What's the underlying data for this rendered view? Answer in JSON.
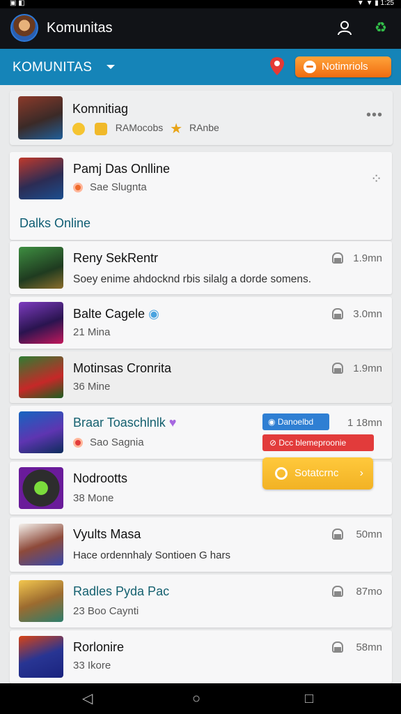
{
  "appbar": {
    "title": "Komunitas",
    "icons": [
      "user-icon",
      "recycle-icon"
    ]
  },
  "subbar": {
    "selector_label": "KOMUNITAS",
    "notif_button": "Notimriols"
  },
  "profile": {
    "name": "Komnitiag",
    "meta_text": "RAMocobs",
    "meta_text2": "RAnbe",
    "more": "•••"
  },
  "cards": [
    {
      "title": "Pamj Das Onlline",
      "subtitle": "Sae Slugnta",
      "section": "Dalks Online"
    },
    {
      "title": "Reny SekRentr",
      "subtitle": "Soey enime ahdocknd rbis silalg a dorde somens.",
      "time": "1.9mn"
    },
    {
      "title": "Balte Cagele",
      "subtitle": "21 Mina",
      "time": "3.0mn"
    },
    {
      "title": "Motinsas Cronrita",
      "subtitle": "36 Mine",
      "time": "1.9mn"
    },
    {
      "title": "Braar Toaschlnlk",
      "subtitle": "Sao Sagnia",
      "time": "1 18mn"
    },
    {
      "title": "Nodrootts",
      "subtitle": "38 Mone"
    },
    {
      "title": "Vyults Masa",
      "subtitle": "Hace ordennhaly Sontioen G hars",
      "time": "50mn"
    },
    {
      "title": "Radles Pyda Pac",
      "subtitle": "23 Boo Caynti",
      "time": "87mo"
    },
    {
      "title": "Rorlonire",
      "subtitle": "33 Ikore",
      "time": "58mn"
    }
  ],
  "actions": {
    "blue": "Danoelbd",
    "red": "Dcc blemeproonie",
    "yellow": "Sotatcrnc"
  },
  "nav": {
    "back": "◁",
    "home": "○",
    "recent": "□"
  }
}
